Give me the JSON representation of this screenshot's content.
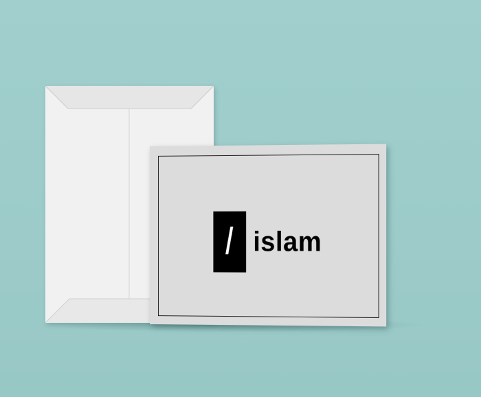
{
  "card": {
    "logo_text": "islam"
  },
  "colors": {
    "background": "#9dccca",
    "card": "#dcdcdc",
    "envelope": "#f1f1f1",
    "logo_block": "#000000"
  }
}
